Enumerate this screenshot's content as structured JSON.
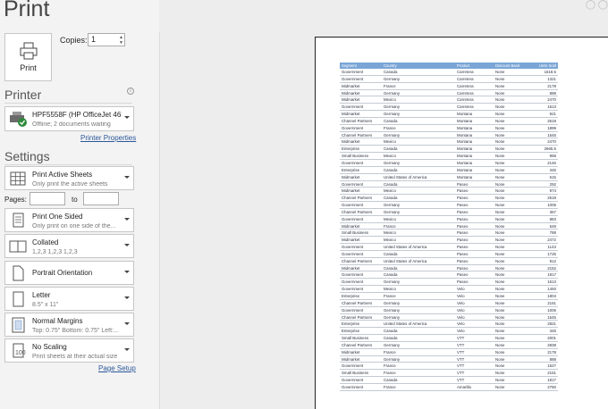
{
  "title": "Print",
  "print_button": {
    "label": "Print"
  },
  "copies": {
    "label": "Copies:",
    "value": "1"
  },
  "printer": {
    "section_title": "Printer",
    "name": "HPF5558F (HP OfficeJet 463...",
    "status": "Offline; 2 documents waiting",
    "properties_link": "Printer Properties"
  },
  "settings": {
    "section_title": "Settings",
    "items": [
      {
        "title": "Print Active Sheets",
        "subtitle": "Only print the active sheets",
        "icon": "sheets-grid-icon"
      },
      {
        "title": "Print One Sided",
        "subtitle": "Only print on one side of the...",
        "icon": "one-sided-page-icon"
      },
      {
        "title": "Collated",
        "subtitle": "1,2,3    1,2,3    1,2,3",
        "icon": "collated-pages-icon"
      },
      {
        "title": "Portrait Orientation",
        "subtitle": "",
        "icon": "portrait-page-icon"
      },
      {
        "title": "Letter",
        "subtitle": "8.5\" x 11\"",
        "icon": "letter-page-icon"
      },
      {
        "title": "Normal Margins",
        "subtitle": "Top: 0.75\" Bottom: 0.75\" Left:...",
        "icon": "margins-icon"
      },
      {
        "title": "No Scaling",
        "subtitle": "Print sheets at their actual size",
        "icon": "scaling-icon"
      }
    ],
    "pages_label": "Pages:",
    "to_label": "to",
    "page_setup_link": "Page Setup"
  },
  "preview": {
    "headers": [
      "Segment",
      "Country",
      "Product",
      "Discount Band",
      "Units Sold"
    ],
    "rows": [
      [
        "Government",
        "Canada",
        "Carretera",
        "None",
        "1618.5"
      ],
      [
        "Government",
        "Germany",
        "Carretera",
        "None",
        "1321"
      ],
      [
        "Midmarket",
        "France",
        "Carretera",
        "None",
        "2178"
      ],
      [
        "Midmarket",
        "Germany",
        "Carretera",
        "None",
        "888"
      ],
      [
        "Midmarket",
        "Mexico",
        "Carretera",
        "None",
        "2470"
      ],
      [
        "Government",
        "Germany",
        "Carretera",
        "None",
        "1513"
      ],
      [
        "Midmarket",
        "Germany",
        "Montana",
        "None",
        "921"
      ],
      [
        "Channel Partners",
        "Canada",
        "Montana",
        "None",
        "2518"
      ],
      [
        "Government",
        "France",
        "Montana",
        "None",
        "1899"
      ],
      [
        "Channel Partners",
        "Germany",
        "Montana",
        "None",
        "1545"
      ],
      [
        "Midmarket",
        "Mexico",
        "Montana",
        "None",
        "2470"
      ],
      [
        "Enterprise",
        "Canada",
        "Montana",
        "None",
        "2665.5"
      ],
      [
        "Small Business",
        "Mexico",
        "Montana",
        "None",
        "958"
      ],
      [
        "Government",
        "Germany",
        "Montana",
        "None",
        "2146"
      ],
      [
        "Enterprise",
        "Canada",
        "Montana",
        "None",
        "345"
      ],
      [
        "Midmarket",
        "United States of America",
        "Montana",
        "None",
        "615"
      ],
      [
        "Government",
        "Canada",
        "Paseo",
        "None",
        "292"
      ],
      [
        "Midmarket",
        "Mexico",
        "Paseo",
        "None",
        "974"
      ],
      [
        "Channel Partners",
        "Canada",
        "Paseo",
        "None",
        "2518"
      ],
      [
        "Government",
        "Germany",
        "Paseo",
        "None",
        "1006"
      ],
      [
        "Channel Partners",
        "Germany",
        "Paseo",
        "None",
        "367"
      ],
      [
        "Government",
        "Mexico",
        "Paseo",
        "None",
        "883"
      ],
      [
        "Midmarket",
        "France",
        "Paseo",
        "None",
        "549"
      ],
      [
        "Small Business",
        "Mexico",
        "Paseo",
        "None",
        "788"
      ],
      [
        "Midmarket",
        "Mexico",
        "Paseo",
        "None",
        "2472"
      ],
      [
        "Government",
        "United States of America",
        "Paseo",
        "None",
        "1143"
      ],
      [
        "Government",
        "Canada",
        "Paseo",
        "None",
        "1725"
      ],
      [
        "Channel Partners",
        "United States of America",
        "Paseo",
        "None",
        "912"
      ],
      [
        "Midmarket",
        "Canada",
        "Paseo",
        "None",
        "2152"
      ],
      [
        "Government",
        "Canada",
        "Paseo",
        "None",
        "1817"
      ],
      [
        "Government",
        "Germany",
        "Paseo",
        "None",
        "1513"
      ],
      [
        "Government",
        "Mexico",
        "Velo",
        "None",
        "1493"
      ],
      [
        "Enterprise",
        "France",
        "Velo",
        "None",
        "1804"
      ],
      [
        "Channel Partners",
        "Germany",
        "Velo",
        "None",
        "2161"
      ],
      [
        "Government",
        "Germany",
        "Velo",
        "None",
        "1006"
      ],
      [
        "Channel Partners",
        "Germany",
        "Velo",
        "None",
        "1545"
      ],
      [
        "Enterprise",
        "United States of America",
        "Velo",
        "None",
        "2821"
      ],
      [
        "Enterprise",
        "Canada",
        "Velo",
        "None",
        "345"
      ],
      [
        "Small Business",
        "Canada",
        "VTT",
        "None",
        "2001"
      ],
      [
        "Channel Partners",
        "Germany",
        "VTT",
        "None",
        "2838"
      ],
      [
        "Midmarket",
        "France",
        "VTT",
        "None",
        "2178"
      ],
      [
        "Midmarket",
        "Germany",
        "VTT",
        "None",
        "888"
      ],
      [
        "Government",
        "France",
        "VTT",
        "None",
        "1527"
      ],
      [
        "Small Business",
        "France",
        "VTT",
        "None",
        "2151"
      ],
      [
        "Government",
        "Canada",
        "VTT",
        "None",
        "1817"
      ],
      [
        "Government",
        "France",
        "Amarilla",
        "None",
        "2750"
      ]
    ]
  },
  "colors": {
    "header_blue": "#7aa5d6",
    "link_blue": "#2b579a",
    "panel_gray": "#f3f3f3"
  }
}
